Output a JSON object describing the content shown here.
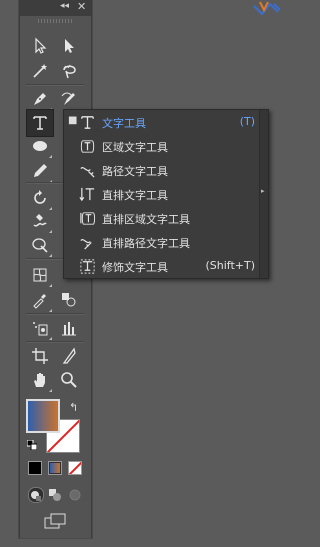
{
  "panel": {
    "collapse_glyph": "◂◂",
    "close_glyph": "✕"
  },
  "tools": [
    {
      "name": "selection-tool",
      "icon": "selection-arrow-icon"
    },
    {
      "name": "direct-selection-tool",
      "icon": "direct-selection-icon"
    },
    {
      "name": "magic-wand-tool",
      "icon": "magic-wand-icon"
    },
    {
      "name": "lasso-tool",
      "icon": "lasso-icon"
    },
    {
      "name": "pen-tool",
      "icon": "pen-icon"
    },
    {
      "name": "curvature-tool",
      "icon": "curvature-icon"
    },
    {
      "name": "type-tool",
      "icon": "type-T-icon",
      "active": true
    },
    {
      "name": "ellipse-tool",
      "icon": "ellipse-icon"
    },
    {
      "name": "pencil-tool",
      "icon": "pencil-icon"
    },
    {
      "name": "rotate-tool",
      "icon": "rotate-icon"
    },
    {
      "name": "warp-tool",
      "icon": "warp-icon"
    },
    {
      "name": "free-transform-tool",
      "icon": "free-transform-icon"
    },
    {
      "name": "mesh-tool",
      "icon": "mesh-icon"
    },
    {
      "name": "eyedropper-tool",
      "icon": "eyedropper-icon"
    },
    {
      "name": "symbol-sprayer-tool",
      "icon": "symbol-sprayer-icon"
    },
    {
      "name": "column-graph-tool",
      "icon": "column-graph-icon"
    },
    {
      "name": "artboard-tool",
      "icon": "artboard-icon"
    },
    {
      "name": "slice-tool",
      "icon": "slice-knife-icon"
    },
    {
      "name": "hand-tool",
      "icon": "hand-icon"
    },
    {
      "name": "zoom-tool",
      "icon": "zoom-icon"
    }
  ],
  "colors": {
    "fill_gradient_start": "#2f5fae",
    "fill_gradient_end": "#c9732e",
    "none_slash": "#e02424",
    "highlight_text": "#6aa6ff",
    "panel_bg": "#535353",
    "flyout_bg": "#3c3c3c"
  },
  "flyout": {
    "items": [
      {
        "label": "文字工具",
        "shortcut": "(T)",
        "icon": "type-T-icon",
        "selected": true
      },
      {
        "label": "区域文字工具",
        "shortcut": "",
        "icon": "area-type-icon"
      },
      {
        "label": "路径文字工具",
        "shortcut": "",
        "icon": "path-type-icon"
      },
      {
        "label": "直排文字工具",
        "shortcut": "",
        "icon": "vertical-type-icon"
      },
      {
        "label": "直排区域文字工具",
        "shortcut": "",
        "icon": "vertical-area-type-icon"
      },
      {
        "label": "直排路径文字工具",
        "shortcut": "",
        "icon": "vertical-path-type-icon"
      },
      {
        "label": "修饰文字工具",
        "shortcut": "(Shift+T)",
        "icon": "touch-type-icon"
      }
    ],
    "bullet": "■"
  }
}
